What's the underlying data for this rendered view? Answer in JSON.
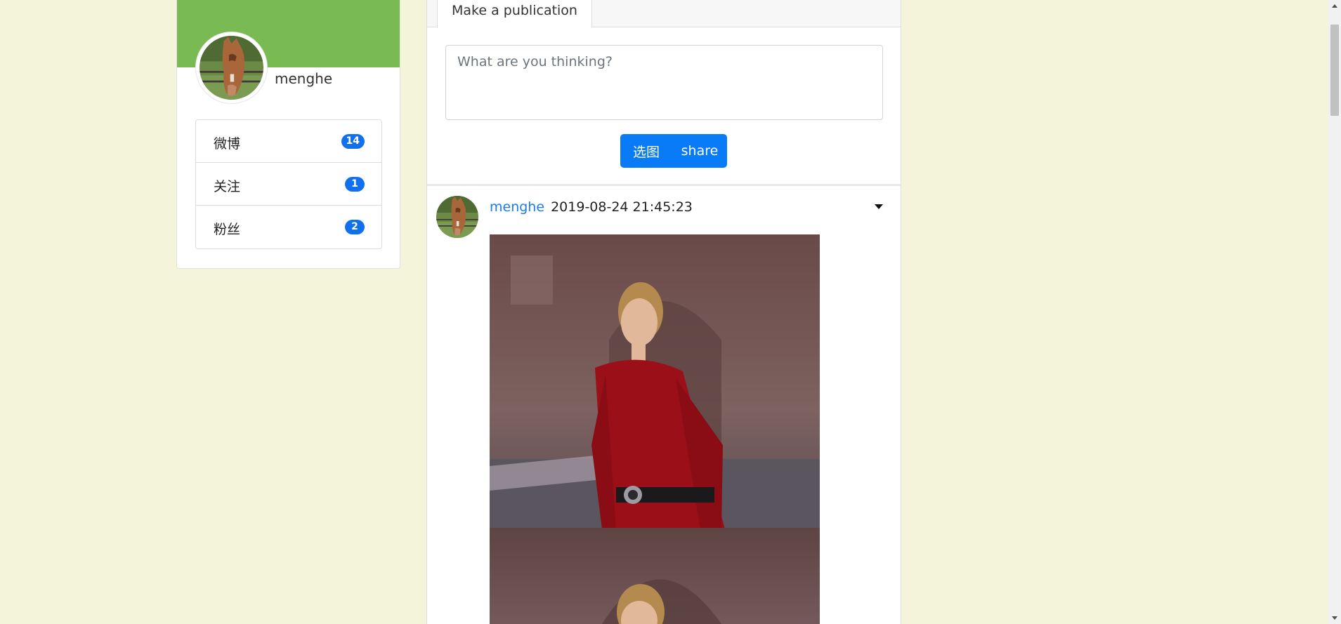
{
  "profile": {
    "username": "menghe",
    "avatar_icon": "horse-avatar",
    "cover_color": "#7aba52",
    "stats": [
      {
        "label": "微博",
        "count": "14"
      },
      {
        "label": "关注",
        "count": "1"
      },
      {
        "label": "粉丝",
        "count": "2"
      }
    ]
  },
  "composer": {
    "tab_label": "Make a publication",
    "placeholder": "What are you thinking?",
    "pick_image_label": "选图",
    "share_label": "share",
    "button_color": "#0a7bf6"
  },
  "post": {
    "author": "menghe",
    "timestamp": "2019-08-24 21:45:23",
    "menu_icon": "caret-down-icon",
    "images": [
      "woman-in-red-dress-photo",
      "woman-in-red-dress-photo"
    ]
  },
  "colors": {
    "page_background": "#f4f4da",
    "badge": "#1070ee",
    "link": "#1a7cf0"
  }
}
